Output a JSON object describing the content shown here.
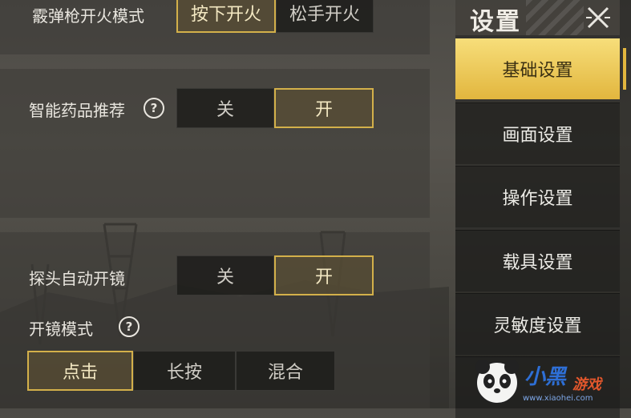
{
  "settings": {
    "shotgun_fire_mode": {
      "label": "霰弹枪开火模式",
      "options": [
        "按下开火",
        "松手开火"
      ],
      "selected": "按下开火"
    },
    "smart_medicine": {
      "label": "智能药品推荐",
      "help": "?",
      "options": [
        "关",
        "开"
      ],
      "selected": "开"
    },
    "peek_auto_scope": {
      "label": "探头自动开镜",
      "options": [
        "关",
        "开"
      ],
      "selected": "开"
    },
    "scope_mode": {
      "label": "开镜模式",
      "help": "?",
      "options": [
        "点击",
        "长按",
        "混合"
      ],
      "selected": "点击"
    }
  },
  "sidebar": {
    "title": "设置",
    "close_icon": "close-x-icon",
    "items": [
      {
        "label": "基础设置",
        "active": true
      },
      {
        "label": "画面设置",
        "active": false
      },
      {
        "label": "操作设置",
        "active": false
      },
      {
        "label": "载具设置",
        "active": false
      },
      {
        "label": "灵敏度设置",
        "active": false
      }
    ]
  },
  "watermark": {
    "brand": "小黑",
    "sub": "游戏",
    "url": "www.xiaohei.com",
    "icon": "panda-logo"
  },
  "colors": {
    "accent_gold": "#d3b04a",
    "active_tab_top": "#f7de7a",
    "active_tab_bottom": "#e2b63e"
  }
}
